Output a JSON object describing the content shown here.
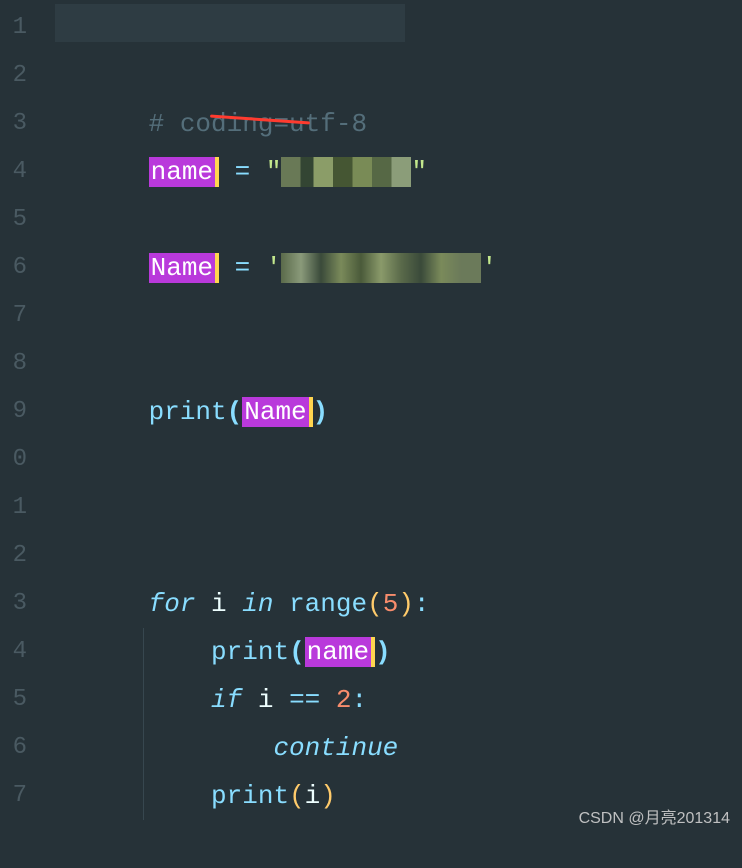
{
  "gutter": {
    "lines": [
      "1",
      "2",
      "3",
      "4",
      "5",
      "6",
      "7",
      "8",
      "9",
      "0",
      "1",
      "2",
      "3",
      "4",
      "5",
      "6",
      "7"
    ]
  },
  "code": {
    "line1_comment": "# coding=utf-8",
    "line3_var": "name",
    "line3_op": " = ",
    "line3_q1": "\"",
    "line3_q2": "\"",
    "line5_var": "Name",
    "line5_op": " = ",
    "line5_q1": "'",
    "line5_q2": "'",
    "line8_func": "print",
    "line8_arg": "Name",
    "line12_for": "for",
    "line12_i": " i ",
    "line12_in": "in",
    "line12_range": " range",
    "line12_lp": "(",
    "line12_num": "5",
    "line12_rp": ")",
    "line12_colon": ":",
    "line13_indent": "    ",
    "line13_func": "print",
    "line13_lp": "(",
    "line13_arg": "name",
    "line13_rp": ")",
    "line14_indent": "    ",
    "line14_if": "if",
    "line14_cond": " i ",
    "line14_op": "==",
    "line14_num": " 2",
    "line14_colon": ":",
    "line15_indent": "        ",
    "line15_kw": "continue",
    "line16_indent": "    ",
    "line16_func": "print",
    "line16_lp": "(",
    "line16_arg": "i",
    "line16_rp": ")"
  },
  "watermark": "CSDN @月亮201314"
}
